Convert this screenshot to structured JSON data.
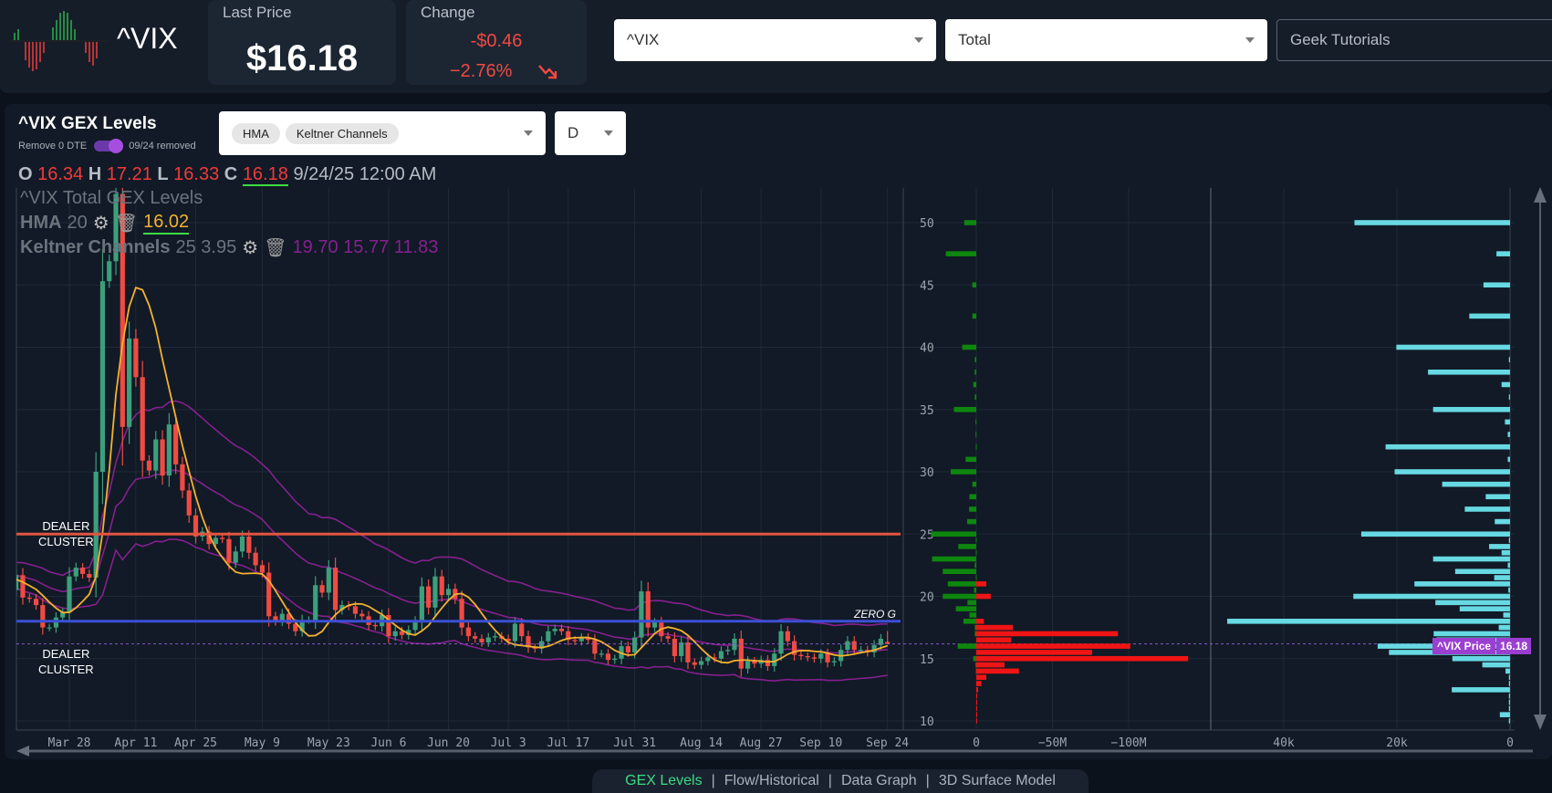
{
  "header": {
    "symbol": "^VIX",
    "last_price_label": "Last Price",
    "last_price": "$16.18",
    "change_label": "Change",
    "change_abs": "-$0.46",
    "change_pct": "−2.76%",
    "trend_icon": "trend-down-arrow",
    "ticker_select": "^VIX",
    "type_select": "Total",
    "tutorials_select": "Geek Tutorials"
  },
  "panel": {
    "title": "^VIX GEX Levels",
    "toggle_label": "Remove 0 DTE",
    "toggle_on": true,
    "removed_text": "09/24 removed",
    "indicator_chips": [
      "HMA",
      "Keltner Channels"
    ],
    "timeframe": "D"
  },
  "ohlc": {
    "o_label": "O",
    "o": "16.34",
    "h_label": "H",
    "h": "17.21",
    "l_label": "L",
    "l": "16.33",
    "c_label": "C",
    "c": "16.18",
    "datetime": "9/24/25 12:00 AM"
  },
  "legend": {
    "series_title": "^VIX Total GEX Levels",
    "hma_label": "HMA",
    "hma_period": "20",
    "hma_value": "16.02",
    "keltner_label": "Keltner Channels",
    "keltner_params": "25 3.95",
    "keltner_values": "19.70 15.77 11.83"
  },
  "annotations": {
    "dealer_cluster_upper": [
      "DEALER",
      "CLUSTER"
    ],
    "dealer_cluster_lower": [
      "DEALER",
      "CLUSTER"
    ],
    "zero_g": "ZERO G",
    "price_tag_label": "^VIX Price",
    "price_tag_value": "16.18"
  },
  "colors": {
    "up": "#3d9f7c",
    "down": "#ef4b43",
    "hma": "#f4b12f",
    "keltner": "#86208f",
    "dealer_line": "#e0553f",
    "zero_g_line": "#3c4fd6",
    "gex_pos": "#0d870d",
    "gex_neg": "#f01414",
    "right_bars": "#67d9e3",
    "accent_tab": "#3ddc84",
    "price_tag": "#9b3fd1"
  },
  "chart_data": [
    {
      "type": "candlestick",
      "y_range": [
        10,
        52
      ],
      "y_ticks": [
        10,
        15,
        20,
        25,
        30,
        35,
        40,
        45,
        50
      ],
      "x_ticks": [
        {
          "label": "Mar 28",
          "index": 10
        },
        {
          "label": "Apr 11",
          "index": 20
        },
        {
          "label": "Apr 25",
          "index": 29
        },
        {
          "label": "May 9",
          "index": 39
        },
        {
          "label": "May 23",
          "index": 49
        },
        {
          "label": "Jun 6",
          "index": 58
        },
        {
          "label": "Jun 20",
          "index": 67
        },
        {
          "label": "Jul 3",
          "index": 76
        },
        {
          "label": "Jul 17",
          "index": 85
        },
        {
          "label": "Jul 31",
          "index": 95
        },
        {
          "label": "Aug 14",
          "index": 105
        },
        {
          "label": "Aug 27",
          "index": 114
        },
        {
          "label": "Sep 10",
          "index": 123
        },
        {
          "label": "Sep 24",
          "index": 133
        }
      ],
      "closes": [
        21.8,
        20.5,
        21.7,
        19.9,
        19.8,
        19.3,
        17.5,
        17.5,
        18.3,
        18.7,
        21.6,
        22.3,
        21.8,
        21.5,
        30.0,
        45.3,
        46.9,
        52.3,
        33.6,
        40.7,
        37.6,
        30.9,
        30.1,
        32.6,
        29.7,
        33.8,
        30.6,
        28.5,
        26.5,
        24.8,
        25.2,
        24.2,
        24.7,
        24.6,
        22.7,
        23.6,
        24.8,
        23.5,
        22.5,
        21.9,
        18.4,
        18.0,
        18.6,
        17.8,
        17.2,
        18.1,
        18.1,
        20.9,
        20.3,
        22.3,
        18.9,
        19.3,
        19.2,
        18.6,
        18.4,
        17.7,
        17.6,
        18.5,
        16.8,
        17.2,
        16.9,
        17.3,
        18.0,
        20.8,
        19.1,
        21.6,
        20.1,
        20.6,
        19.8,
        17.5,
        16.8,
        16.6,
        16.3,
        16.7,
        16.8,
        16.6,
        16.4,
        17.8,
        16.8,
        15.9,
        15.8,
        16.4,
        17.2,
        17.4,
        17.2,
        16.5,
        16.4,
        16.7,
        16.5,
        15.4,
        15.4,
        14.9,
        15.0,
        16.0,
        15.5,
        16.7,
        20.4,
        17.5,
        17.9,
        16.8,
        16.6,
        15.2,
        16.3,
        14.7,
        14.5,
        14.8,
        15.1,
        15.0,
        15.6,
        15.7,
        16.6,
        14.2,
        14.8,
        14.6,
        14.9,
        14.4,
        15.4,
        17.2,
        16.4,
        15.3,
        15.2,
        15.1,
        15.0,
        15.4,
        14.7,
        14.8,
        15.7,
        16.4,
        15.7,
        15.7,
        15.5,
        16.1,
        16.6,
        16.18
      ],
      "last_candle": {
        "open": 16.34,
        "high": 17.21,
        "low": 16.33,
        "close": 16.18
      },
      "levels": {
        "dealer_cluster": 25,
        "zero_g": 18,
        "price": 16.18
      }
    },
    {
      "type": "horizontal-bar",
      "x_ticks": [
        "0",
        "−50M",
        "−100M"
      ],
      "x_range_millions": [
        20,
        -150
      ],
      "right_x_ticks": [
        "40k",
        "20k",
        "0"
      ],
      "rows_strike_pos_neg_right": [
        [
          50,
          7.9,
          0,
          27.5
        ],
        [
          47.5,
          20,
          0,
          2.4
        ],
        [
          45,
          2.6,
          0,
          4.7
        ],
        [
          42.5,
          2.6,
          0,
          7.2
        ],
        [
          40,
          9.2,
          0,
          20.1
        ],
        [
          39,
          1,
          0,
          0.2
        ],
        [
          38,
          1,
          0,
          14.5
        ],
        [
          37,
          2,
          0,
          1.5
        ],
        [
          36,
          1,
          0,
          0.2
        ],
        [
          35,
          14.7,
          0,
          13.6
        ],
        [
          34,
          0.5,
          0,
          0.9
        ],
        [
          33,
          0.5,
          0,
          0.4
        ],
        [
          32,
          0.3,
          0,
          22
        ],
        [
          31,
          7,
          0,
          0.4
        ],
        [
          30,
          16.8,
          0,
          20.4
        ],
        [
          29,
          2.6,
          0,
          12
        ],
        [
          28,
          4.5,
          0,
          4.3
        ],
        [
          27,
          4.7,
          0,
          8
        ],
        [
          26,
          6,
          0,
          2.7
        ],
        [
          25,
          29.7,
          0,
          26.3
        ],
        [
          24.5,
          0.3,
          0,
          0.2
        ],
        [
          24,
          11.8,
          0,
          3.7
        ],
        [
          23.5,
          0.3,
          0,
          1.5
        ],
        [
          23,
          29,
          0,
          13.6
        ],
        [
          22.5,
          1,
          0,
          0.4
        ],
        [
          22,
          22,
          0,
          9.7
        ],
        [
          21.5,
          0.3,
          0,
          2.8
        ],
        [
          21,
          18.7,
          -6.6,
          16.9
        ],
        [
          20.5,
          1.5,
          0,
          0.3
        ],
        [
          20,
          22,
          -9.5,
          27.7
        ],
        [
          19.5,
          5.8,
          0,
          13.2
        ],
        [
          19,
          13.4,
          0,
          8.9
        ],
        [
          18.5,
          4.5,
          0,
          1.2
        ],
        [
          18,
          8.4,
          -5,
          50
        ],
        [
          17.5,
          1,
          -24,
          2
        ],
        [
          17,
          1,
          -93,
          13.5
        ],
        [
          16.5,
          0,
          -23,
          13
        ],
        [
          16,
          12.2,
          -101,
          23.4
        ],
        [
          15.5,
          0,
          -76,
          21.4
        ],
        [
          15,
          2,
          -139,
          10.2
        ],
        [
          14.5,
          0.5,
          -18.5,
          4.9
        ],
        [
          14,
          0.3,
          -28,
          0.8
        ],
        [
          13.5,
          0,
          -6.6,
          0.2
        ],
        [
          13,
          0,
          -3.4,
          0.2
        ],
        [
          12.5,
          0,
          -1.2,
          10.3
        ],
        [
          12,
          0,
          -0.5,
          0.2
        ],
        [
          11.5,
          0,
          -0.3,
          0.2
        ],
        [
          11,
          0,
          -0.2,
          0.2
        ],
        [
          10.5,
          0,
          -0.2,
          1.8
        ],
        [
          10,
          0,
          -0.2,
          0.2
        ]
      ]
    }
  ],
  "bottom_tabs": [
    {
      "label": "GEX Levels",
      "active": true
    },
    {
      "label": "Flow/Historical"
    },
    {
      "label": "Data Graph"
    },
    {
      "label": "3D Surface Model"
    }
  ],
  "tab_separator": "|"
}
